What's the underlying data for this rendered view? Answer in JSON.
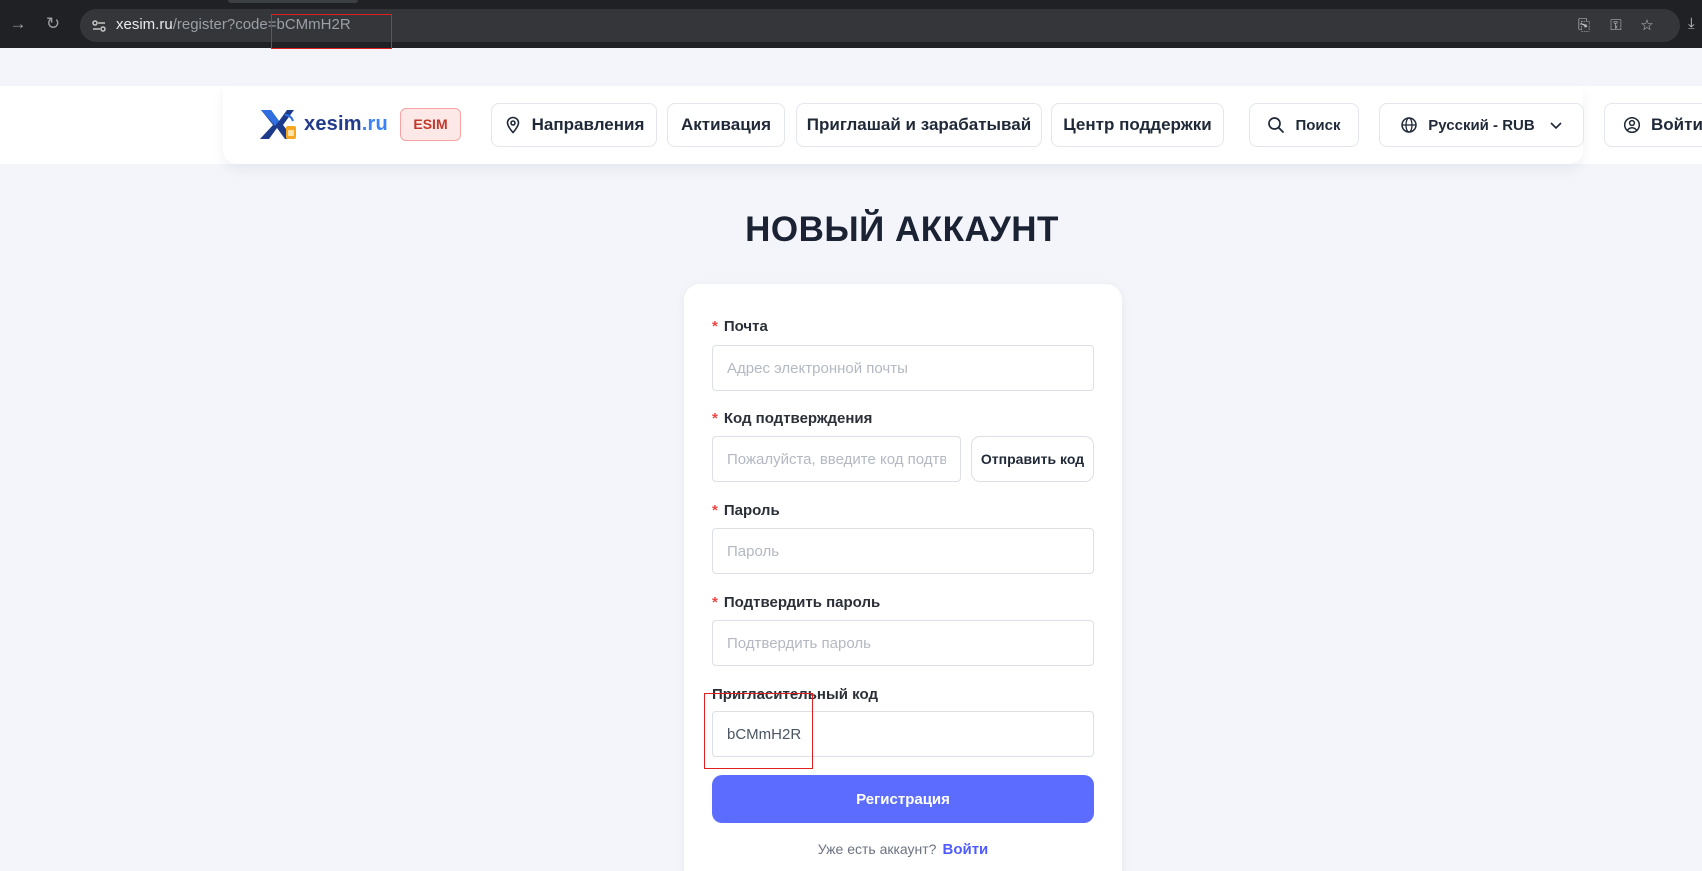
{
  "browser": {
    "url_host": "xesim.ru",
    "url_path": "/register?code=bCMmH2R",
    "icons": [
      "arrow-right-icon",
      "reload-icon",
      "site-info-icon",
      "translate-icon",
      "password-key-icon",
      "bookmark-star-icon",
      "download-icon"
    ]
  },
  "site": {
    "logo_name": "xesim",
    "logo_tld": ".ru",
    "badge": "ESIM",
    "nav": {
      "destinations": "Направления",
      "activation": "Активация",
      "invite": "Приглашай и зарабатывай",
      "support": "Центр поддержки",
      "search": "Поиск",
      "language": "Русский - RUB",
      "login": "Войти"
    },
    "colors": {
      "accent": "#5b6cff",
      "required": "#ef4444",
      "badge_text": "#c0392b"
    }
  },
  "form": {
    "title": "НОВЫЙ АККАУНТ",
    "required_mark": "*",
    "email": {
      "label": "Почта",
      "placeholder": "Адрес электронной почты",
      "value": ""
    },
    "code": {
      "label": "Код подтверждения",
      "placeholder": "Пожалуйста, введите код подтверждения",
      "value": ""
    },
    "send_code": "Отправить код",
    "password": {
      "label": "Пароль",
      "placeholder": "Пароль",
      "value": ""
    },
    "confirm": {
      "label": "Подтвердить пароль",
      "placeholder": "Подтвердить пароль",
      "value": ""
    },
    "invite": {
      "label": "Пригласительный код",
      "placeholder": "",
      "value": "bCMmH2R"
    },
    "submit": "Регистрация",
    "have_account": "Уже есть аккаунт?",
    "login_link": "Войти"
  }
}
